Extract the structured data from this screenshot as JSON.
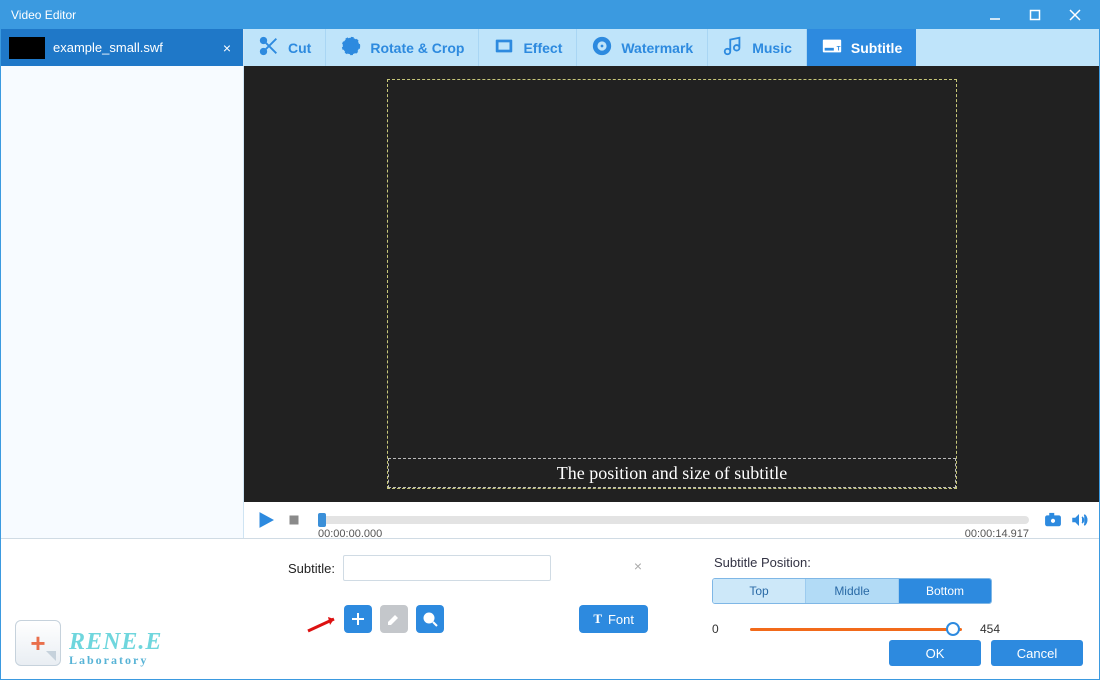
{
  "window": {
    "title": "Video Editor"
  },
  "sidebar": {
    "file": {
      "name": "example_small.swf"
    }
  },
  "tabs": [
    {
      "id": "cut",
      "label": "Cut",
      "icon": "scissors-icon"
    },
    {
      "id": "rotate",
      "label": "Rotate & Crop",
      "icon": "crop-rotate-icon"
    },
    {
      "id": "effect",
      "label": "Effect",
      "icon": "effect-icon"
    },
    {
      "id": "watermark",
      "label": "Watermark",
      "icon": "watermark-icon"
    },
    {
      "id": "music",
      "label": "Music",
      "icon": "music-note-icon"
    },
    {
      "id": "subtitle",
      "label": "Subtitle",
      "icon": "subtitle-icon",
      "active": true
    }
  ],
  "preview": {
    "placeholder_text": "The position and size of subtitle"
  },
  "playback": {
    "start_time": "00:00:00.000",
    "end_time": "00:00:14.917"
  },
  "subtitle_panel": {
    "field_label": "Subtitle:",
    "field_value": "",
    "font_button": "Font",
    "position_label": "Subtitle Position:",
    "segments": {
      "top": "Top",
      "middle": "Middle",
      "bottom": "Bottom"
    },
    "slider": {
      "min": "0",
      "max": "454"
    }
  },
  "logo": {
    "brand": "RENE.E",
    "sub": "Laboratory"
  },
  "dialog": {
    "ok": "OK",
    "cancel": "Cancel"
  }
}
